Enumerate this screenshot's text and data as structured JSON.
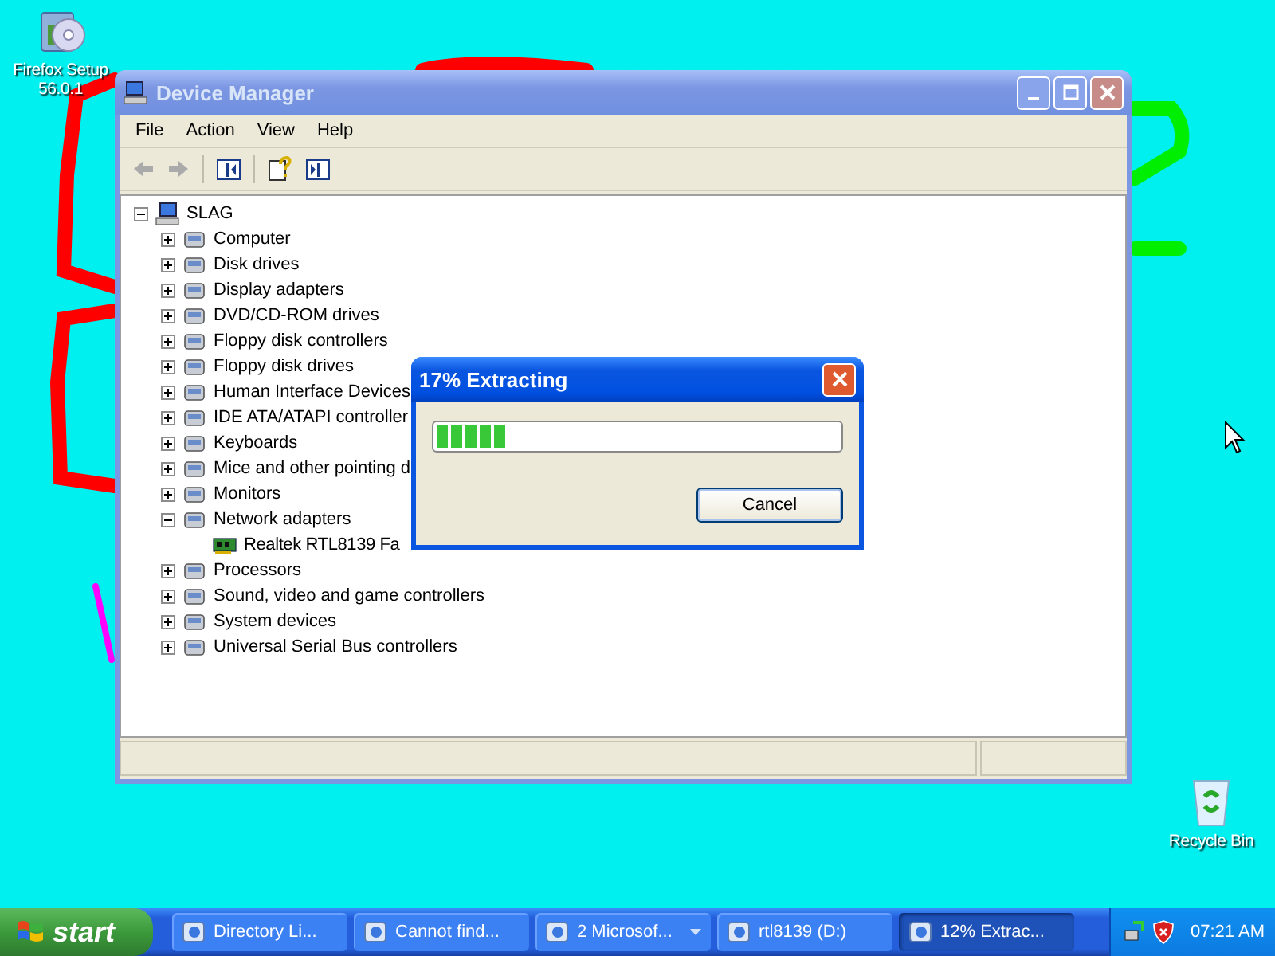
{
  "desktop_icons": [
    {
      "label": "Firefox Setup 56.0.1"
    },
    {
      "label": "Recycle Bin"
    }
  ],
  "device_manager": {
    "title": "Device Manager",
    "active": false,
    "menu": [
      "File",
      "Action",
      "View",
      "Help"
    ],
    "tree": {
      "label": "SLAG",
      "expanded": true,
      "children": [
        {
          "label": "Computer",
          "expanded": false
        },
        {
          "label": "Disk drives",
          "expanded": false
        },
        {
          "label": "Display adapters",
          "expanded": false
        },
        {
          "label": "DVD/CD-ROM drives",
          "expanded": false
        },
        {
          "label": "Floppy disk controllers",
          "expanded": false
        },
        {
          "label": "Floppy disk drives",
          "expanded": false
        },
        {
          "label": "Human Interface Devices",
          "expanded": false
        },
        {
          "label": "IDE ATA/ATAPI controller",
          "expanded": false
        },
        {
          "label": "Keyboards",
          "expanded": false
        },
        {
          "label": "Mice and other pointing d",
          "expanded": false
        },
        {
          "label": "Monitors",
          "expanded": false
        },
        {
          "label": "Network adapters",
          "expanded": true,
          "children": [
            {
              "label": "Realtek RTL8139 Fa"
            }
          ]
        },
        {
          "label": "Processors",
          "expanded": false
        },
        {
          "label": "Sound, video and game controllers",
          "expanded": false
        },
        {
          "label": "System devices",
          "expanded": false
        },
        {
          "label": "Universal Serial Bus controllers",
          "expanded": false
        }
      ]
    }
  },
  "dialog": {
    "title": "17% Extracting",
    "active": true,
    "progress": {
      "level": 0.17
    },
    "button": "Cancel"
  },
  "taskbar": {
    "start": "start",
    "tasks": [
      {
        "label": "Directory Li...",
        "selected": false
      },
      {
        "label": "Cannot find...",
        "selected": false
      },
      {
        "label": "2 Microsof...",
        "selected": false,
        "kind": "group"
      },
      {
        "label": "rtl8139 (D:)",
        "selected": false
      },
      {
        "label": "12% Extrac...",
        "selected": true
      }
    ],
    "clock": "07:21 AM"
  }
}
